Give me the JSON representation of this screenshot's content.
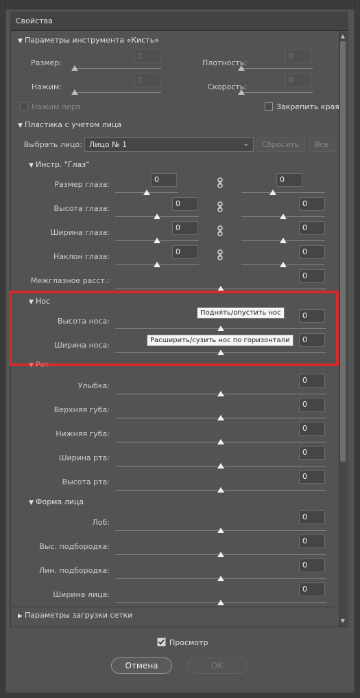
{
  "panel": {
    "title": "Свойства"
  },
  "brush": {
    "title": "Параметры инструмента «Кисть»",
    "size_label": "Размер:",
    "size_value": "1",
    "density_label": "Плотность:",
    "density_value": "0",
    "pressure_label": "Нажим:",
    "pressure_value": "1",
    "rate_label": "Скорость:",
    "rate_value": "0",
    "pen_pressure_label": "Нажим пера",
    "pin_edges_label": "Закрепить края"
  },
  "face_aware": {
    "title": "Пластика с учетом лица",
    "select_face_label": "Выбрать лицо:",
    "select_face_value": "Лицо № 1",
    "reset_label": "Сбросить",
    "all_label": "Все"
  },
  "eyes": {
    "title": "Инстр. \"Глаз\"",
    "rows": [
      {
        "label": "Размер глаза:",
        "left_value": "0",
        "right_value": "0"
      },
      {
        "label": "Высота глаза:",
        "left_value": "0",
        "right_value": "0"
      },
      {
        "label": "Ширина глаза:",
        "left_value": "0",
        "right_value": "0"
      },
      {
        "label": "Наклон глаза:",
        "left_value": "0",
        "right_value": "0"
      }
    ],
    "distance_label": "Межглазное расст.:",
    "distance_value": "0"
  },
  "nose": {
    "title": "Нос",
    "height_label": "Высота носа:",
    "height_value": "0",
    "width_label": "Ширина носа:",
    "width_value": "0",
    "tooltip_height": "Поднять/опустить нос",
    "tooltip_width": "Расширить/сузить нос по горизонтали"
  },
  "mouth": {
    "title": "Рот",
    "rows": [
      {
        "label": "Улыбка:",
        "value": "0"
      },
      {
        "label": "Верхняя губа:",
        "value": "0"
      },
      {
        "label": "Нижняя губа:",
        "value": "0"
      },
      {
        "label": "Ширина рта:",
        "value": "0"
      },
      {
        "label": "Высота рта:",
        "value": "0"
      }
    ]
  },
  "face_shape": {
    "title": "Форма лица",
    "rows": [
      {
        "label": "Лоб:",
        "value": "0"
      },
      {
        "label": "Выс. подбородка:",
        "value": "0"
      },
      {
        "label": "Лин. подбородка:",
        "value": "0"
      },
      {
        "label": "Ширина лица:",
        "value": "0"
      }
    ]
  },
  "mesh": {
    "title": "Параметры загрузки сетки"
  },
  "footer": {
    "preview_label": "Просмотр",
    "preview_checked": true,
    "cancel_label": "Отмена",
    "ok_label": "OK"
  },
  "colors": {
    "highlight": "#d32a2a",
    "panel_bg": "#535353",
    "title_bg": "#434343"
  }
}
